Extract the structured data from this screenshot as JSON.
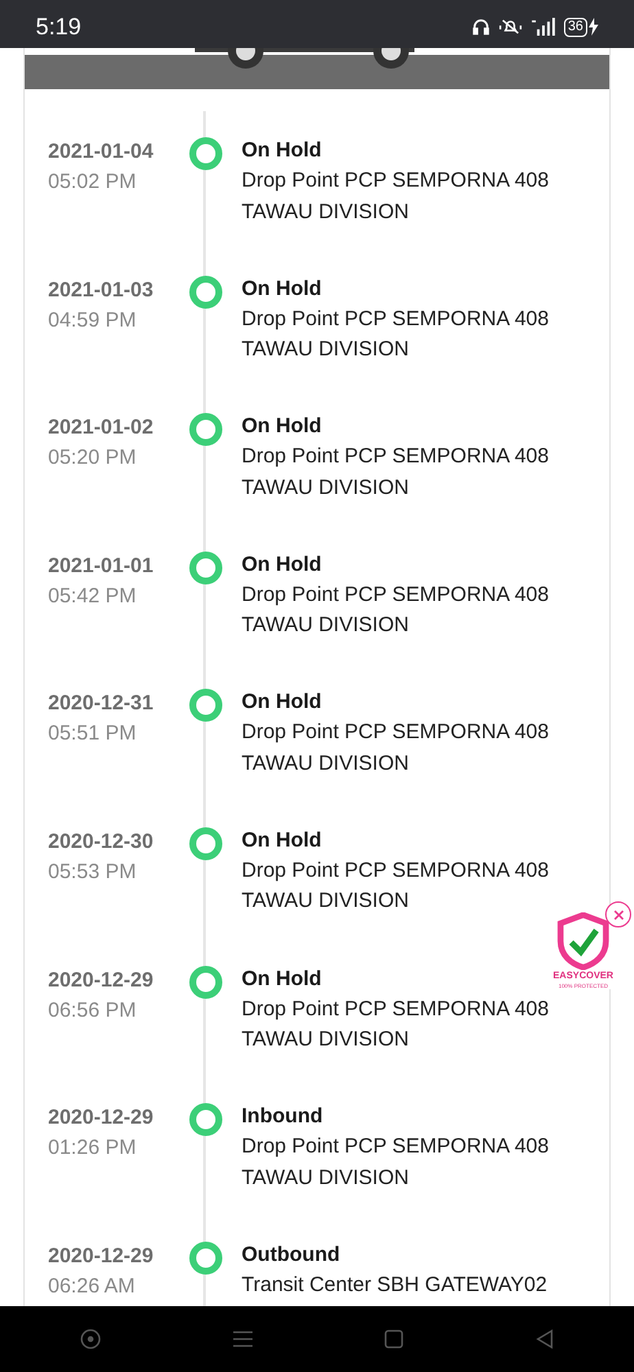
{
  "status_bar": {
    "time": "5:19",
    "battery": "36"
  },
  "events": [
    {
      "date": "2021-01-04",
      "time": "05:02 PM",
      "status": "On Hold",
      "location": "Drop Point PCP SEMPORNA 408 TAWAU DIVISION"
    },
    {
      "date": "2021-01-03",
      "time": "04:59 PM",
      "status": "On Hold",
      "location": "Drop Point PCP SEMPORNA 408 TAWAU DIVISION"
    },
    {
      "date": "2021-01-02",
      "time": "05:20 PM",
      "status": "On Hold",
      "location": "Drop Point PCP SEMPORNA 408 TAWAU DIVISION"
    },
    {
      "date": "2021-01-01",
      "time": "05:42 PM",
      "status": "On Hold",
      "location": "Drop Point PCP SEMPORNA 408 TAWAU DIVISION"
    },
    {
      "date": "2020-12-31",
      "time": "05:51 PM",
      "status": "On Hold",
      "location": "Drop Point PCP SEMPORNA 408 TAWAU DIVISION"
    },
    {
      "date": "2020-12-30",
      "time": "05:53 PM",
      "status": "On Hold",
      "location": "Drop Point PCP SEMPORNA 408 TAWAU DIVISION"
    },
    {
      "date": "2020-12-29",
      "time": "06:56 PM",
      "status": "On Hold",
      "location": "Drop Point PCP SEMPORNA 408 TAWAU DIVISION"
    },
    {
      "date": "2020-12-29",
      "time": "01:26 PM",
      "status": "Inbound",
      "location": "Drop Point PCP SEMPORNA 408 TAWAU DIVISION"
    },
    {
      "date": "2020-12-29",
      "time": "06:26 AM",
      "status": "Outbound",
      "location": "Transit Center SBH GATEWAY02"
    }
  ],
  "badge": {
    "title": "EASYCOVER",
    "subtitle": "100% PROTECTED"
  }
}
